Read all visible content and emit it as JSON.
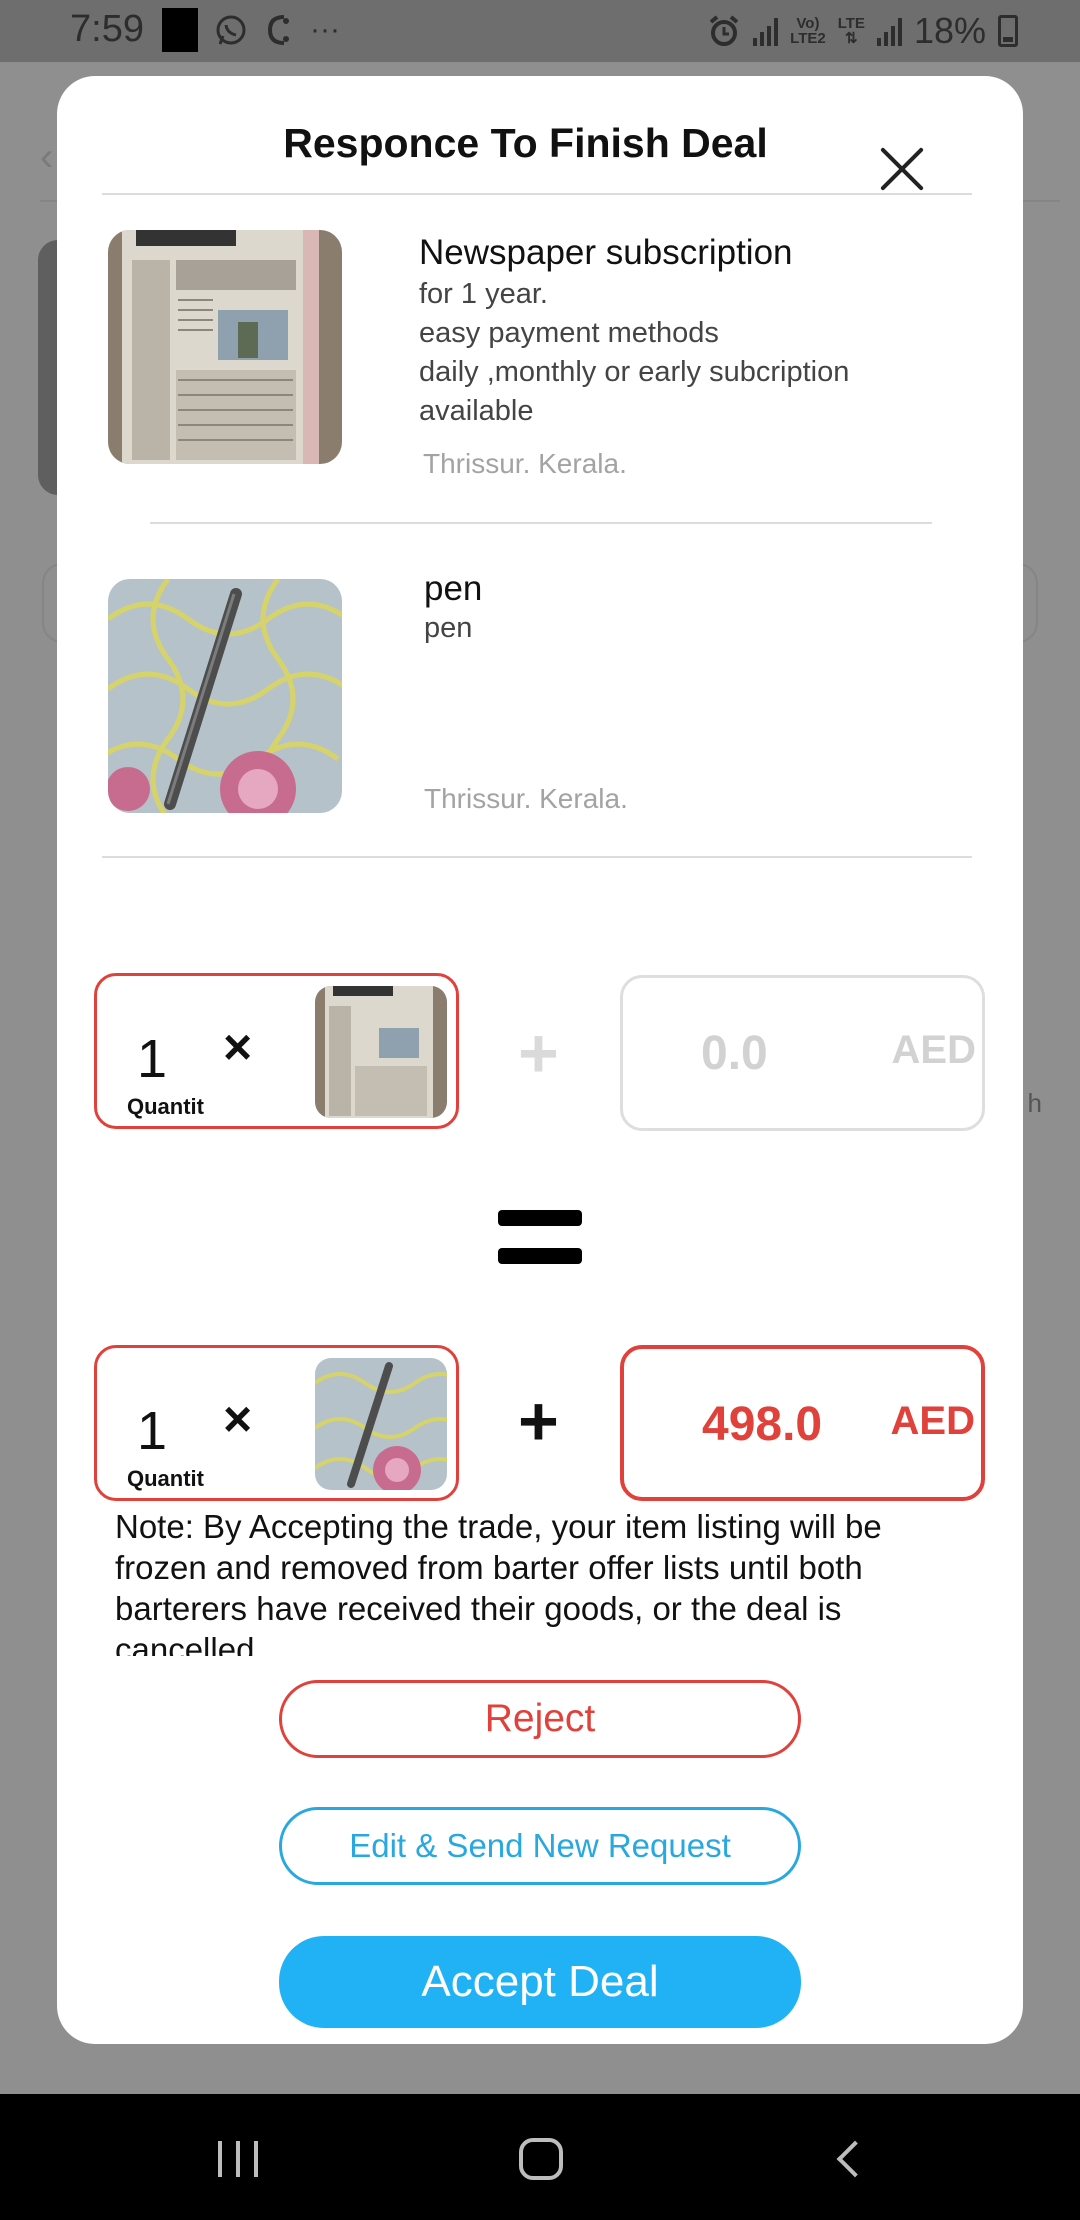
{
  "status_bar": {
    "time": "7:59",
    "notification_icons": [
      "black-square-icon",
      "whatsapp-icon",
      "missed-call-icon",
      "more-icon"
    ],
    "more_glyph": "···",
    "network_label_top": "Vo)",
    "network_label_bottom": "LTE2",
    "lte_label": "LTE",
    "battery": "18%"
  },
  "modal": {
    "title": "Responce To Finish Deal",
    "items": [
      {
        "title": "Newspaper subscription",
        "description": "for 1 year.\neasy payment methods\ndaily ,monthly or early subcription\navailable",
        "location": "Thrissur. Kerala.",
        "image": "newspaper-photo"
      },
      {
        "title": "pen",
        "description": "pen",
        "location": "Thrissur. Kerala.",
        "image": "pen-photo"
      }
    ],
    "offer_row": {
      "quantity": "1",
      "times": "×",
      "quantity_label": "Quantit",
      "plus": "+",
      "amount": "0.0",
      "currency": "AED"
    },
    "equals_icon": "equals-icon",
    "request_row": {
      "quantity": "1",
      "times": "×",
      "quantity_label": "Quantit",
      "plus": "+",
      "amount": "498.0",
      "currency": "AED"
    },
    "note": "Note:  By Accepting the trade, your item listing will be frozen and removed from barter offer lists until both barterers have received their goods, or the deal is cancelled.",
    "buttons": {
      "reject": "Reject",
      "edit": "Edit & Send New Request",
      "accept": "Accept Deal"
    }
  },
  "background": {
    "back_glyph": "‹",
    "partial_text": "h"
  },
  "nav_bar": {
    "recent": "recent-apps-icon",
    "home": "home-icon",
    "back": "back-icon"
  },
  "colors": {
    "red": "#e0413a",
    "blue": "#21b2f5",
    "blue_outline": "#29a8e0",
    "muted": "#a3a3a3"
  }
}
